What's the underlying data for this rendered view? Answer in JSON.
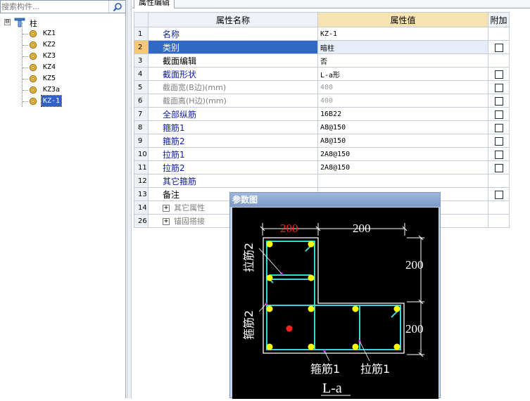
{
  "search": {
    "placeholder": "搜索构件..."
  },
  "tree": {
    "root_label": "柱",
    "expander": "⊟",
    "items": [
      {
        "label": "KZ1"
      },
      {
        "label": "KZ2"
      },
      {
        "label": "KZ3"
      },
      {
        "label": "KZ4"
      },
      {
        "label": "KZ5"
      },
      {
        "label": "KZ3a"
      },
      {
        "label": "KZ-1",
        "selected": true
      }
    ]
  },
  "tab": {
    "label": "属性编辑"
  },
  "grid": {
    "headers": {
      "name": "属性名称",
      "value": "属性值",
      "extra": "附加"
    },
    "rows": [
      {
        "num": "1",
        "name": "名称",
        "value": "KZ-1",
        "checkbox": false
      },
      {
        "num": "2",
        "name": "类别",
        "value": "暗柱",
        "checkbox": true
      },
      {
        "num": "3",
        "name": "截面编辑",
        "value": "否",
        "checkbox": false
      },
      {
        "num": "4",
        "name": "截面形状",
        "value": "L-a形",
        "checkbox": true
      },
      {
        "num": "5",
        "name": "截面宽(B边)(mm)",
        "value": "400",
        "checkbox": true
      },
      {
        "num": "6",
        "name": "截面高(H边)(mm)",
        "value": "400",
        "checkbox": true
      },
      {
        "num": "7",
        "name": "全部纵筋",
        "value": "16B22",
        "checkbox": true
      },
      {
        "num": "8",
        "name": "箍筋1",
        "value": "A8@150",
        "checkbox": true
      },
      {
        "num": "9",
        "name": "箍筋2",
        "value": "A8@150",
        "checkbox": true
      },
      {
        "num": "10",
        "name": "拉筋1",
        "value": "2A8@150",
        "checkbox": true
      },
      {
        "num": "11",
        "name": "拉筋2",
        "value": "2A8@150",
        "checkbox": true
      },
      {
        "num": "12",
        "name": "其它箍筋",
        "value": "",
        "checkbox": false
      },
      {
        "num": "13",
        "name": "备注",
        "value": "",
        "checkbox": true
      },
      {
        "num": "14",
        "name": "其它属性",
        "value": "",
        "checkbox": false
      },
      {
        "num": "26",
        "name": "锚固搭接",
        "value": "",
        "checkbox": false
      }
    ],
    "expand_symbol": "+"
  },
  "popup": {
    "title": "参数图",
    "diagram": {
      "dim_top_left": "200",
      "dim_top_right": "200",
      "dim_right_top": "200",
      "dim_right_bottom": "200",
      "label_lajin2": "拉筋2",
      "label_gujin2": "箍筋2",
      "label_gujin1": "箍筋1",
      "label_lajin1": "拉筋1",
      "shape_name": "L-a",
      "colors": {
        "outline": "#ffffff",
        "stirrup": "#35d6d6",
        "bar": "#ffff00",
        "highlight": "#ff2020",
        "hook": "#e000e0"
      }
    }
  }
}
